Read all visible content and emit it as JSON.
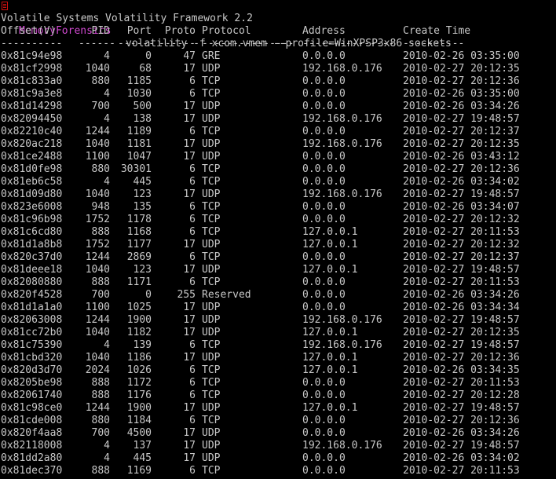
{
  "prompt": {
    "directory": "MemoryForensics",
    "command": "volatility -f xcom.vmem --profile=WinXPSP3x86 sockets"
  },
  "banner": "Volatile Systems Volatility Framework 2.2",
  "table": {
    "headers": [
      "Offset(V)",
      "PID",
      "Port",
      "Proto",
      "Protocol",
      "Address",
      "Create Time"
    ],
    "separators": [
      "----------",
      "------",
      "------",
      "------",
      "---------------",
      "---------------",
      "----------"
    ],
    "rows": [
      [
        "0x81c94e98",
        "4",
        "0",
        "47",
        "GRE",
        "0.0.0.0",
        "2010-02-26 03:35:00"
      ],
      [
        "0x81cf2998",
        "1040",
        "68",
        "17",
        "UDP",
        "192.168.0.176",
        "2010-02-27 20:12:35"
      ],
      [
        "0x81c833a0",
        "880",
        "1185",
        "6",
        "TCP",
        "0.0.0.0",
        "2010-02-27 20:12:36"
      ],
      [
        "0x81c9a3e8",
        "4",
        "1030",
        "6",
        "TCP",
        "0.0.0.0",
        "2010-02-26 03:35:00"
      ],
      [
        "0x81d14298",
        "700",
        "500",
        "17",
        "UDP",
        "0.0.0.0",
        "2010-02-26 03:34:26"
      ],
      [
        "0x82094450",
        "4",
        "138",
        "17",
        "UDP",
        "192.168.0.176",
        "2010-02-27 19:48:57"
      ],
      [
        "0x82210c40",
        "1244",
        "1189",
        "6",
        "TCP",
        "0.0.0.0",
        "2010-02-27 20:12:37"
      ],
      [
        "0x820ac218",
        "1040",
        "1181",
        "17",
        "UDP",
        "192.168.0.176",
        "2010-02-27 20:12:35"
      ],
      [
        "0x81ce2488",
        "1100",
        "1047",
        "17",
        "UDP",
        "0.0.0.0",
        "2010-02-26 03:43:12"
      ],
      [
        "0x81d0fe98",
        "880",
        "30301",
        "6",
        "TCP",
        "0.0.0.0",
        "2010-02-27 20:12:36"
      ],
      [
        "0x81eb6c58",
        "4",
        "445",
        "6",
        "TCP",
        "0.0.0.0",
        "2010-02-26 03:34:02"
      ],
      [
        "0x81d09d80",
        "1040",
        "123",
        "17",
        "UDP",
        "192.168.0.176",
        "2010-02-27 19:48:57"
      ],
      [
        "0x823e6008",
        "948",
        "135",
        "6",
        "TCP",
        "0.0.0.0",
        "2010-02-26 03:34:07"
      ],
      [
        "0x81c96b98",
        "1752",
        "1178",
        "6",
        "TCP",
        "0.0.0.0",
        "2010-02-27 20:12:32"
      ],
      [
        "0x81c6cd80",
        "888",
        "1168",
        "6",
        "TCP",
        "127.0.0.1",
        "2010-02-27 20:11:53"
      ],
      [
        "0x81d1a8b8",
        "1752",
        "1177",
        "17",
        "UDP",
        "127.0.0.1",
        "2010-02-27 20:12:32"
      ],
      [
        "0x820c37d0",
        "1244",
        "2869",
        "6",
        "TCP",
        "0.0.0.0",
        "2010-02-27 20:12:37"
      ],
      [
        "0x81deee18",
        "1040",
        "123",
        "17",
        "UDP",
        "127.0.0.1",
        "2010-02-27 19:48:57"
      ],
      [
        "0x82080880",
        "888",
        "1171",
        "6",
        "TCP",
        "0.0.0.0",
        "2010-02-27 20:11:53"
      ],
      [
        "0x820f4528",
        "700",
        "0",
        "255",
        "Reserved",
        "0.0.0.0",
        "2010-02-26 03:34:26"
      ],
      [
        "0x81d1a1a0",
        "1100",
        "1025",
        "17",
        "UDP",
        "0.0.0.0",
        "2010-02-26 03:34:34"
      ],
      [
        "0x82063008",
        "1244",
        "1900",
        "17",
        "UDP",
        "192.168.0.176",
        "2010-02-27 19:48:57"
      ],
      [
        "0x81cc72b0",
        "1040",
        "1182",
        "17",
        "UDP",
        "127.0.0.1",
        "2010-02-27 20:12:35"
      ],
      [
        "0x81c75390",
        "4",
        "139",
        "6",
        "TCP",
        "192.168.0.176",
        "2010-02-27 19:48:57"
      ],
      [
        "0x81cbd320",
        "1040",
        "1186",
        "17",
        "UDP",
        "127.0.0.1",
        "2010-02-27 20:12:36"
      ],
      [
        "0x820d3d70",
        "2024",
        "1026",
        "6",
        "TCP",
        "127.0.0.1",
        "2010-02-26 03:34:35"
      ],
      [
        "0x8205be98",
        "888",
        "1172",
        "6",
        "TCP",
        "0.0.0.0",
        "2010-02-27 20:11:53"
      ],
      [
        "0x82061740",
        "888",
        "1176",
        "6",
        "TCP",
        "0.0.0.0",
        "2010-02-27 20:12:28"
      ],
      [
        "0x81c98ce0",
        "1244",
        "1900",
        "17",
        "UDP",
        "127.0.0.1",
        "2010-02-27 19:48:57"
      ],
      [
        "0x81cde008",
        "880",
        "1184",
        "6",
        "TCP",
        "0.0.0.0",
        "2010-02-27 20:12:36"
      ],
      [
        "0x820f4aa8",
        "700",
        "4500",
        "17",
        "UDP",
        "0.0.0.0",
        "2010-02-26 03:34:26"
      ],
      [
        "0x82118008",
        "4",
        "137",
        "17",
        "UDP",
        "192.168.0.176",
        "2010-02-27 19:48:57"
      ],
      [
        "0x81dd2a80",
        "4",
        "445",
        "17",
        "UDP",
        "0.0.0.0",
        "2010-02-26 03:34:02"
      ],
      [
        "0x81dec370",
        "888",
        "1169",
        "6",
        "TCP",
        "0.0.0.0",
        "2010-02-27 20:11:53"
      ]
    ]
  },
  "colors": {
    "background": "#000000",
    "text": "#c8c8c8",
    "prompt_directory": "#d24ad2",
    "prompt_icon": "#d01010"
  }
}
